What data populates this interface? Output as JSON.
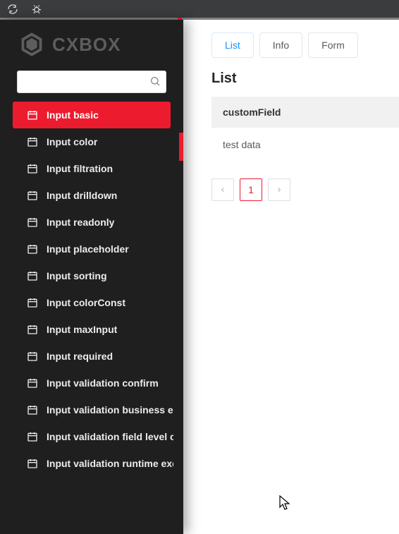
{
  "brand": {
    "name": "CXBOX"
  },
  "search": {
    "placeholder": ""
  },
  "sidebar": {
    "items": [
      {
        "label": "Input basic",
        "active": true
      },
      {
        "label": "Input color",
        "active": false
      },
      {
        "label": "Input filtration",
        "active": false
      },
      {
        "label": "Input drilldown",
        "active": false
      },
      {
        "label": "Input readonly",
        "active": false
      },
      {
        "label": "Input placeholder",
        "active": false
      },
      {
        "label": "Input sorting",
        "active": false
      },
      {
        "label": "Input colorConst",
        "active": false
      },
      {
        "label": "Input maxInput",
        "active": false
      },
      {
        "label": "Input required",
        "active": false
      },
      {
        "label": "Input validation confirm",
        "active": false
      },
      {
        "label": "Input validation business ex",
        "active": false
      },
      {
        "label": "Input validation field level cu",
        "active": false
      },
      {
        "label": "Input validation runtime exc",
        "active": false
      }
    ]
  },
  "tabs": [
    {
      "label": "List",
      "active": true
    },
    {
      "label": "Info",
      "active": false
    },
    {
      "label": "Form",
      "active": false
    }
  ],
  "page": {
    "title": "List"
  },
  "table": {
    "columns": [
      "customField"
    ],
    "rows": [
      {
        "customField": "test data"
      }
    ]
  },
  "pagination": {
    "current": "1"
  }
}
